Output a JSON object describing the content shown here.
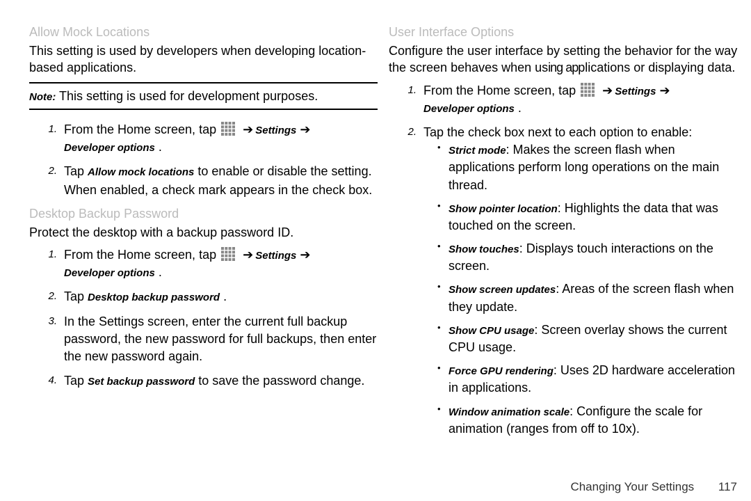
{
  "left": {
    "sec1_head": "Allow Mock Locations",
    "sec1_para": "This setting is used by developers when developing location-based applications.",
    "note_prefix": "Note:",
    "note_text": " This setting is used for development purposes.",
    "sec1_step1_p1": "From the Home screen, tap",
    "settings_label": "Settings",
    "arrow": " ➔ ",
    "devopts": "Developer options",
    "period": " .",
    "sec1_step2_p1": "Tap ",
    "sec1_step2_em": "Allow mock locations",
    "sec1_step2_p2": " to enable or disable the setting.",
    "sec1_step2_cont": "When enabled, a check mark appears in the check box.",
    "sec2_head": "Desktop Backup Password",
    "sec2_para": "Protect the desktop with a backup password ID.",
    "sec2_step1_p1": "From the Home screen, tap",
    "sec2_step2_p1": "Tap ",
    "sec2_step2_em": "Desktop backup password",
    "sec2_step3": "In the Settings screen, enter the current full backup password, the new password for full backups, then enter the new password again.",
    "sec2_step4_p1": "Tap ",
    "sec2_step4_em": "Set backup password",
    "sec2_step4_p2": " to save the password change."
  },
  "right": {
    "sec1_head": "User Interface Options",
    "sec1_para_a": "Configure the user interface by setting the behavior for the way the screen behaves when us",
    "sec1_para_b": "ing ap",
    "sec1_para_c": "plications or displaying data.",
    "step1_p1": "From the Home screen, tap",
    "step2": "Tap the check box next to each option to enable:",
    "items": [
      {
        "name": "Strict mode",
        "desc": ": Makes the screen flash when applications perform long operations on the main thread."
      },
      {
        "name": "Show pointer location",
        "desc": ": Highlights the data that was touched on the screen."
      },
      {
        "name": "Show touches",
        "desc": ": Displays touch interactions on the screen."
      },
      {
        "name": "Show screen updates",
        "desc": ": Areas of the screen flash when they update."
      },
      {
        "name": "Show CPU usage",
        "desc": ": Screen overlay shows the current CPU usage."
      },
      {
        "name": "Force GPU rendering",
        "desc": ": Uses 2D hardware acceleration in applications."
      },
      {
        "name": "Window animation scale",
        "desc": ": Configure the scale for animation (ranges from off to 10x)."
      }
    ]
  },
  "footer": {
    "title": "Changing Your Settings",
    "page": "117"
  },
  "num": {
    "n1": "1.",
    "n2": "2.",
    "n3": "3.",
    "n4": "4."
  }
}
